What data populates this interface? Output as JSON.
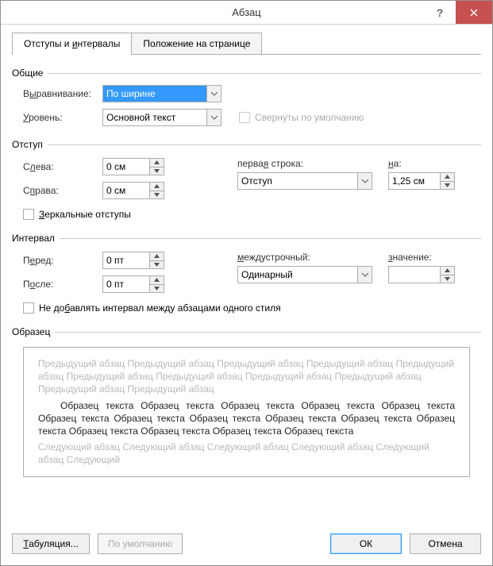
{
  "title": "Абзац",
  "tabs": {
    "t1": "Отступы и интервалы",
    "t2": "Положение на странице"
  },
  "group_general": "Общие",
  "alignment_label_pre": "В",
  "alignment_label_u": "ы",
  "alignment_label_post": "равнивание:",
  "alignment_value": "По ширине",
  "level_label_pre": "",
  "level_label_u": "У",
  "level_label_post": "ровень:",
  "level_value": "Основной текст",
  "collapsed_label": "Свернуты по умолчанию",
  "group_indent": "Отступ",
  "left_label_pre": "С",
  "left_label_u": "л",
  "left_label_post": "ева:",
  "left_value": "0 см",
  "right_label_pre": "С",
  "right_label_u": "п",
  "right_label_post": "рава:",
  "right_value": "0 см",
  "firstline_label_pre": "перва",
  "firstline_label_u": "я",
  "firstline_label_post": " строка:",
  "firstline_value": "Отступ",
  "on_label_pre": "",
  "on_label_u": "н",
  "on_label_post": "а:",
  "on_value": "1,25 см",
  "mirror_label_pre": "",
  "mirror_label_u": "З",
  "mirror_label_post": "еркальные отступы",
  "group_spacing": "Интервал",
  "before_label_pre": "П",
  "before_label_u": "е",
  "before_label_post": "ред:",
  "before_value": "0 пт",
  "after_label_pre": "П",
  "after_label_u": "о",
  "after_label_post": "сле:",
  "after_value": "0 пт",
  "linespacing_label_pre": "",
  "linespacing_label_u": "м",
  "linespacing_label_post": "еждустрочный:",
  "linespacing_value": "Одинарный",
  "value_label_pre": "",
  "value_label_u": "з",
  "value_label_post": "начение:",
  "value_value": "",
  "noadd_label_pre": "Не до",
  "noadd_label_u": "б",
  "noadd_label_post": "авлять интервал между абзацами одного стиля",
  "group_preview": "Образец",
  "preview_prev": "Предыдущий абзац Предыдущий абзац Предыдущий абзац Предыдущий абзац Предыдущий абзац Предыдущий абзац Предыдущий абзац Предыдущий абзац Предыдущий абзац Предыдущий абзац Предыдущий абзац",
  "preview_sample": "Образец текста Образец текста Образец текста Образец текста Образец текста Образец текста Образец текста Образец текста Образец текста Образец текста Образец текста Образец текста Образец текста Образец текста Образец текста",
  "preview_next": "Следующий абзац Следующий абзац Следующий абзац Следующий абзац Следующий абзац Следующий",
  "btn_tabs_pre": "",
  "btn_tabs_u": "Т",
  "btn_tabs_post": "абуляция...",
  "btn_default": "По умолчанию",
  "btn_ok": "ОК",
  "btn_cancel": "Отмена"
}
